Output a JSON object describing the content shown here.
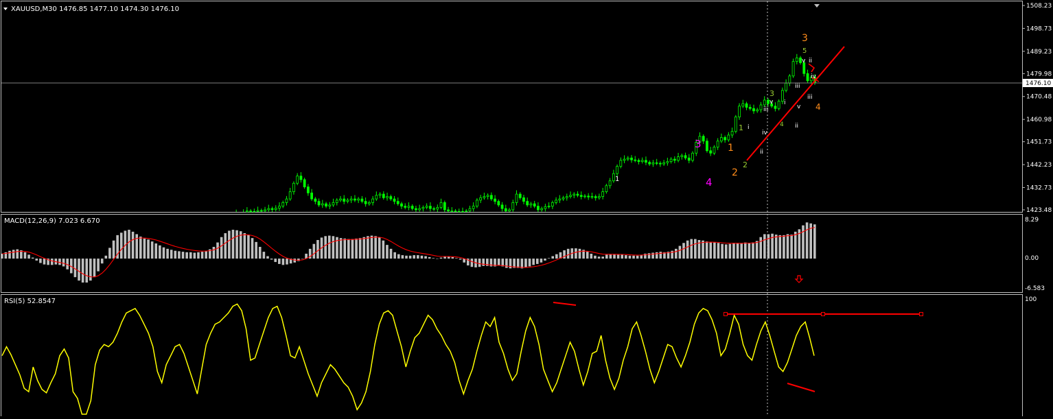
{
  "colors": {
    "background": "#000000",
    "frame": "#c0c0c0",
    "grid": "#808080",
    "bull_candle": "#00ff00",
    "bear_candle": "#00ff00",
    "macd_hist": "#c0c0c0",
    "macd_signal": "#ff0000",
    "rsi_line": "#ffff00",
    "trendline": "#ff0000",
    "text": "#ffffff",
    "wave_orange": "#ff8c1a",
    "wave_magenta": "#ff00ff",
    "wave_green": "#9acd32"
  },
  "main": {
    "header_text": "XAUUSD,M30  1476.85 1477.10 1474.30 1476.10",
    "collapse_icon": "triangle-down-icon",
    "scroll_marker_icon": "triangle-down-icon",
    "price_tag": "1476.10",
    "price_labels": [
      "1508.23",
      "1498.73",
      "1489.23",
      "1479.98",
      "1470.48",
      "1460.98",
      "1451.73",
      "1442.23",
      "1432.73",
      "1423.48"
    ],
    "wave_labels": [
      {
        "text": "3",
        "color": "orange"
      },
      {
        "text": "5",
        "color": "green"
      },
      {
        "text": "v",
        "color": "white"
      },
      {
        "text": "ii",
        "color": "white"
      },
      {
        "text": "iv",
        "color": "white"
      },
      {
        "text": "iii",
        "color": "white"
      },
      {
        "text": "4",
        "color": "orange"
      },
      {
        "text": "iii",
        "color": "white"
      },
      {
        "text": "3",
        "color": "green"
      },
      {
        "text": "v",
        "color": "white"
      },
      {
        "text": "iii",
        "color": "white"
      },
      {
        "text": "i",
        "color": "white"
      },
      {
        "text": "v",
        "color": "white"
      },
      {
        "text": "ii",
        "color": "white"
      },
      {
        "text": "iv",
        "color": "white"
      },
      {
        "text": "4",
        "color": "green"
      },
      {
        "text": "1",
        "color": "green"
      },
      {
        "text": "i",
        "color": "white"
      },
      {
        "text": "ii",
        "color": "white"
      },
      {
        "text": "1",
        "color": "orange"
      },
      {
        "text": "2",
        "color": "green"
      },
      {
        "text": "2",
        "color": "orange"
      },
      {
        "text": "3",
        "color": "magenta"
      },
      {
        "text": "4",
        "color": "magenta"
      },
      {
        "text": "1",
        "color": "white"
      }
    ]
  },
  "macd": {
    "header_text": "MACD(12,26,9) 7.023 6.670",
    "scale_labels": [
      "8.29",
      "0.00",
      "-6.583"
    ],
    "arrow_icon": "arrow-down-icon"
  },
  "rsi": {
    "header_text": "RSI(5) 52.8547",
    "scale_labels": [
      "100"
    ]
  },
  "chart_data": [
    {
      "type": "candlestick",
      "title": "XAUUSD,M30",
      "symbol": "XAUUSD",
      "timeframe": "M30",
      "last_bar": {
        "open": 1476.85,
        "high": 1477.1,
        "low": 1474.3,
        "close": 1476.1
      },
      "ylim": [
        1423.48,
        1508.23
      ],
      "y_ticks": [
        1508.23,
        1498.73,
        1489.23,
        1479.98,
        1470.48,
        1460.98,
        1451.73,
        1442.23,
        1432.73,
        1423.48
      ],
      "current_price": 1476.1,
      "close_series_approx": [
        1420.5,
        1420.8,
        1421.2,
        1421.0,
        1421.5,
        1422.0,
        1421.8,
        1422.5,
        1423.0,
        1422.6,
        1422.8,
        1423.2,
        1423.0,
        1423.5,
        1424.0,
        1423.6,
        1424.2,
        1425.0,
        1426.5,
        1428.0,
        1431.0,
        1434.5,
        1437.5,
        1436.0,
        1433.0,
        1430.5,
        1428.0,
        1427.0,
        1425.5,
        1426.0,
        1425.0,
        1425.5,
        1426.5,
        1427.5,
        1428.0,
        1427.0,
        1427.5,
        1428.0,
        1427.5,
        1428.0,
        1427.0,
        1426.0,
        1426.5,
        1428.0,
        1429.5,
        1430.0,
        1428.5,
        1429.0,
        1428.0,
        1427.0,
        1426.0,
        1425.0,
        1424.5,
        1425.0,
        1424.0,
        1423.5,
        1424.0,
        1424.5,
        1425.0,
        1424.0,
        1423.8,
        1424.5,
        1426.5,
        1423.5,
        1423.0,
        1423.0,
        1422.8,
        1422.5,
        1422.8,
        1423.0,
        1424.0,
        1425.0,
        1427.5,
        1428.5,
        1429.0,
        1429.5,
        1428.0,
        1427.0,
        1425.5,
        1424.0,
        1423.0,
        1423.5,
        1426.5,
        1430.0,
        1428.5,
        1427.0,
        1425.5,
        1426.0,
        1425.0,
        1423.5,
        1424.0,
        1424.8,
        1425.0,
        1426.5,
        1427.5,
        1428.0,
        1428.5,
        1429.0,
        1429.5,
        1430.0,
        1429.5,
        1429.0,
        1429.2,
        1428.8,
        1429.0,
        1428.5,
        1429.0,
        1431.0,
        1433.5,
        1435.5,
        1438.5,
        1441.5,
        1444.0,
        1444.5,
        1445.0,
        1444.2,
        1444.0,
        1443.5,
        1444.0,
        1443.2,
        1442.5,
        1443.0,
        1442.8,
        1442.5,
        1443.0,
        1443.5,
        1444.5,
        1444.0,
        1445.5,
        1446.0,
        1445.0,
        1444.0,
        1447.0,
        1451.5,
        1454.0,
        1452.0,
        1448.0,
        1447.0,
        1449.5,
        1452.0,
        1453.5,
        1452.5,
        1454.5,
        1456.0,
        1462.0,
        1466.5,
        1467.5,
        1466.0,
        1465.5,
        1464.5,
        1465.0,
        1467.0,
        1469.0,
        1467.5,
        1466.5,
        1465.5,
        1468.5,
        1473.0,
        1476.0,
        1479.0,
        1485.0,
        1486.5,
        1484.5,
        1480.0,
        1477.0,
        1478.5,
        1476.1
      ],
      "trendline": {
        "from": 1444.0,
        "to": 1483.5
      },
      "horizontal_line": 1476.1
    },
    {
      "type": "histogram",
      "title": "MACD(12,26,9)",
      "macd_value": 7.023,
      "signal_value": 6.67,
      "ylim": [
        -6.583,
        8.29
      ],
      "y_ticks": [
        8.29,
        0.0,
        -6.583
      ],
      "histogram_values_approx": [
        1.0,
        1.3,
        1.6,
        1.8,
        1.9,
        1.7,
        1.3,
        0.8,
        0.2,
        -0.4,
        -0.9,
        -1.2,
        -1.3,
        -1.3,
        -1.2,
        -1.3,
        -1.6,
        -2.2,
        -3.0,
        -3.8,
        -4.5,
        -4.9,
        -4.9,
        -4.5,
        -3.8,
        -2.6,
        -1.0,
        0.6,
        2.2,
        3.7,
        4.8,
        5.3,
        5.7,
        5.9,
        5.5,
        5.0,
        4.5,
        4.1,
        3.9,
        3.5,
        3.1,
        2.7,
        2.3,
        2.0,
        1.8,
        1.6,
        1.5,
        1.4,
        1.3,
        1.3,
        1.2,
        1.3,
        1.4,
        1.6,
        1.9,
        2.4,
        3.3,
        4.4,
        5.2,
        5.7,
        5.9,
        5.8,
        5.6,
        5.2,
        4.8,
        4.2,
        3.4,
        2.4,
        1.4,
        0.5,
        -0.2,
        -0.7,
        -1.1,
        -1.3,
        -1.2,
        -1.0,
        -0.8,
        -0.5,
        0.0,
        1.0,
        2.0,
        3.0,
        3.8,
        4.3,
        4.6,
        4.7,
        4.6,
        4.4,
        4.2,
        4.1,
        4.0,
        4.0,
        4.1,
        4.2,
        4.4,
        4.6,
        4.7,
        4.6,
        4.3,
        3.7,
        2.8,
        2.0,
        1.3,
        0.9,
        0.7,
        0.6,
        0.6,
        0.7,
        0.7,
        0.6,
        0.5,
        0.3,
        0.1,
        0.0,
        0.2,
        0.4,
        0.4,
        0.3,
        0.1,
        -0.2,
        -0.8,
        -1.4,
        -1.7,
        -1.8,
        -1.7,
        -1.5,
        -1.5,
        -1.6,
        -1.6,
        -1.4,
        -1.6,
        -1.9,
        -2.0,
        -1.9,
        -1.9,
        -2.0,
        -1.8,
        -1.6,
        -1.3,
        -1.1,
        -0.8,
        -0.4,
        0.1,
        0.5,
        0.9,
        1.3,
        1.7,
        2.0,
        2.1,
        2.1,
        2.0,
        1.8,
        1.4,
        1.0,
        0.6,
        0.4,
        0.4,
        0.8,
        0.9,
        0.9,
        0.8,
        0.8,
        0.7,
        0.6,
        0.6,
        0.6,
        0.8,
        1.0,
        1.1,
        1.2,
        1.3,
        1.4,
        1.3,
        1.4,
        1.6,
        2.0,
        2.6,
        3.2,
        3.7,
        4.0,
        4.0,
        3.8,
        3.7,
        3.5,
        3.4,
        3.3,
        3.2,
        3.0,
        2.9,
        3.0,
        3.2,
        3.1,
        3.1,
        3.3,
        3.2,
        3.3,
        3.6,
        4.4,
        5.0,
        5.0,
        5.1,
        4.9,
        4.8,
        4.8,
        5.0,
        4.9,
        5.5,
        6.0,
        6.8,
        7.4,
        7.2,
        7.0
      ]
    },
    {
      "type": "line",
      "title": "RSI(5)",
      "last_value": 52.8547,
      "ylim": [
        0,
        100
      ],
      "y_ticks": [
        100
      ],
      "values_approx": [
        52,
        60,
        53,
        44,
        35,
        23,
        20,
        42,
        30,
        22,
        19,
        28,
        36,
        52,
        58,
        50,
        20,
        14,
        0,
        0,
        12,
        44,
        57,
        62,
        60,
        64,
        72,
        82,
        90,
        92,
        94,
        88,
        80,
        72,
        60,
        38,
        28,
        44,
        52,
        60,
        62,
        54,
        42,
        30,
        18,
        40,
        62,
        72,
        80,
        82,
        86,
        90,
        96,
        98,
        92,
        76,
        48,
        50,
        62,
        74,
        86,
        94,
        96,
        86,
        70,
        52,
        50,
        60,
        48,
        36,
        26,
        16,
        28,
        36,
        44,
        40,
        34,
        28,
        24,
        16,
        4,
        10,
        20,
        38,
        62,
        80,
        90,
        92,
        88,
        74,
        60,
        42,
        56,
        68,
        72,
        80,
        88,
        84,
        76,
        70,
        62,
        56,
        46,
        30,
        18,
        30,
        40,
        56,
        70,
        82,
        78,
        86,
        64,
        54,
        40,
        30,
        36,
        56,
        74,
        86,
        78,
        62,
        40,
        30,
        20,
        28,
        40,
        52,
        64,
        56,
        40,
        26,
        38,
        54,
        56,
        70,
        48,
        32,
        22,
        32,
        48,
        60,
        76,
        82,
        70,
        56,
        40,
        28,
        38,
        50,
        62,
        60,
        50,
        42,
        52,
        64,
        80,
        90,
        94,
        92,
        84,
        72,
        52,
        58,
        72,
        88,
        80,
        62,
        52,
        48,
        62,
        74,
        82,
        70,
        56,
        42,
        38,
        46,
        58,
        70,
        78,
        82,
        68,
        52
      ],
      "annotations": [
        {
          "type": "horizontal_line",
          "value": 89
        }
      ]
    }
  ]
}
